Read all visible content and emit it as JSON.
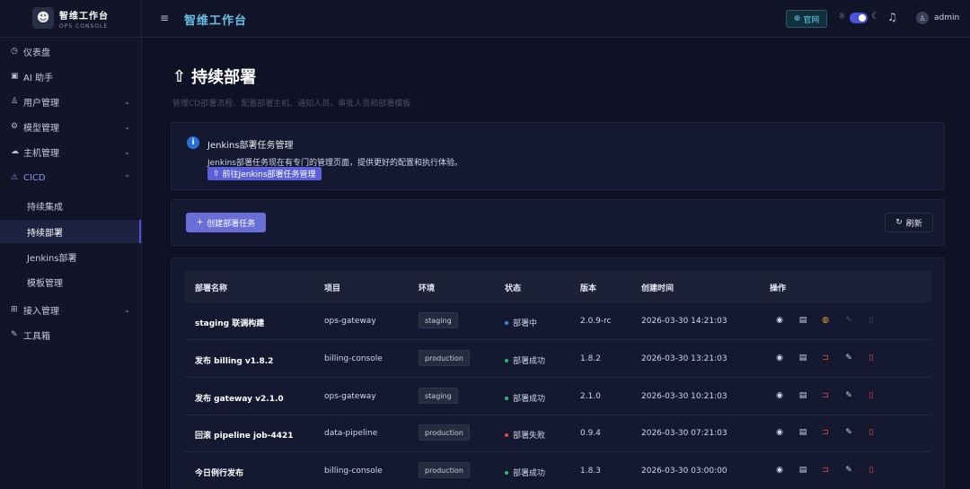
{
  "brand": {
    "name": "智维工作台",
    "sub": "OPS CONSOLE",
    "logo_icon": "robot-logo"
  },
  "sidebar": {
    "items": [
      {
        "label": "仪表盘",
        "icon": "dashboard-icon"
      },
      {
        "label": "AI 助手",
        "icon": "ai-icon"
      },
      {
        "label": "用户管理",
        "icon": "user-icon",
        "expandable": true
      },
      {
        "label": "模型管理",
        "icon": "model-icon",
        "expandable": true
      },
      {
        "label": "主机管理",
        "icon": "host-icon",
        "expandable": true
      },
      {
        "label": "CICD",
        "icon": "cicd-icon",
        "expandable": true,
        "open": true
      },
      {
        "label": "持续集成",
        "sub": true
      },
      {
        "label": "持续部署",
        "sub": true,
        "active": true
      },
      {
        "label": "Jenkins部署",
        "sub": true
      },
      {
        "label": "模板管理",
        "sub": true
      },
      {
        "label": "接入管理",
        "icon": "access-icon",
        "expandable": true
      },
      {
        "label": "工具箱",
        "icon": "tool-icon"
      }
    ]
  },
  "topbar": {
    "title": "智维工作台",
    "official": "官网",
    "user": "admin"
  },
  "page": {
    "title": "持续部署",
    "description": "管理CD部署流程、配置部署主机、通知人员、审批人员和部署模板"
  },
  "notice": {
    "title": "Jenkins部署任务管理",
    "description": "Jenkins部署任务现在有专门的管理页面，提供更好的配置和执行体验。",
    "button": "前往Jenkins部署任务管理"
  },
  "toolbar": {
    "create": "创建部署任务",
    "refresh": "刷新"
  },
  "table": {
    "headers": [
      "部署名称",
      "项目",
      "环境",
      "状态",
      "版本",
      "创建时间",
      "操作"
    ],
    "rows": [
      {
        "name": "staging 联调构建",
        "project": "ops-gateway",
        "env": "staging",
        "status": "部署中",
        "status_color": "#3b82f6",
        "version": "2.0.9-rc",
        "created": "2026-03-30 14:21:03",
        "running": true
      },
      {
        "name": "发布 billing v1.8.2",
        "project": "billing-console",
        "env": "production",
        "status": "部署成功",
        "status_color": "#22c55e",
        "version": "1.8.2",
        "created": "2026-03-30 13:21:03",
        "running": false
      },
      {
        "name": "发布 gateway v2.1.0",
        "project": "ops-gateway",
        "env": "staging",
        "status": "部署成功",
        "status_color": "#22c55e",
        "version": "2.1.0",
        "created": "2026-03-30 10:21:03",
        "running": false
      },
      {
        "name": "回滚 pipeline job-4421",
        "project": "data-pipeline",
        "env": "production",
        "status": "部署失败",
        "status_color": "#ef4444",
        "version": "0.9.4",
        "created": "2026-03-30 07:21:03",
        "running": false
      },
      {
        "name": "今日例行发布",
        "project": "billing-console",
        "env": "production",
        "status": "部署成功",
        "status_color": "#22c55e",
        "version": "1.8.3",
        "created": "2026-03-30 03:00:00",
        "running": false
      }
    ]
  }
}
